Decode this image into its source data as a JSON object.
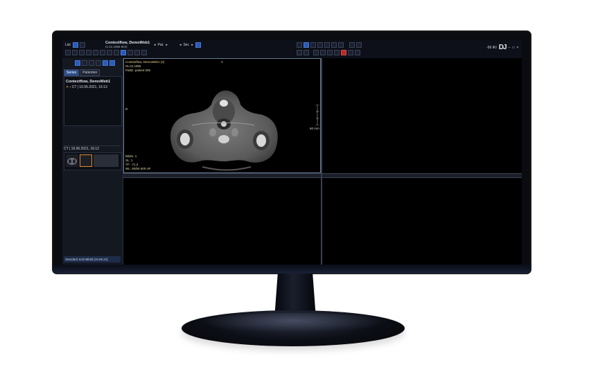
{
  "toolbar": {
    "list_label": "List",
    "patient_title": "Contextflow, DemoWeb1",
    "patient_sub": "(1.01.1955 80J)",
    "pat_label": "Pat.",
    "ser_label": "Ser.",
    "zoom_label": "-56 IKI",
    "logo": "DJ",
    "window_close": "×"
  },
  "leftpanel": {
    "tabs": [
      {
        "label": "Series"
      },
      {
        "label": "Patienten"
      }
    ],
    "patient_name": "Contextflow, DemoWeb1",
    "study_line": "CT | 10.06.2021, 16:13",
    "series_header": "CT | 19.06.2021, 16:12",
    "bottom_status": "Standard Schnittbild [19.06.21]"
  },
  "viewport": {
    "top_left": {
      "line1": "Contextflow, DemoWeb1 (4)",
      "line2": "01.01.1955",
      "line3": "PatID: patient 005",
      "bottom1": "Bildnr. 1",
      "bottom2": "SL: 1",
      "bottom3": "TF: -71,3",
      "bottom4": "WL: 60/50 500 HF",
      "scale": "60 mm",
      "orient_top": "A",
      "orient_left": "R"
    }
  },
  "colors": {
    "accent": "#2c4f8c",
    "overlay_text": "#e0d9b0",
    "background": "#000000"
  }
}
